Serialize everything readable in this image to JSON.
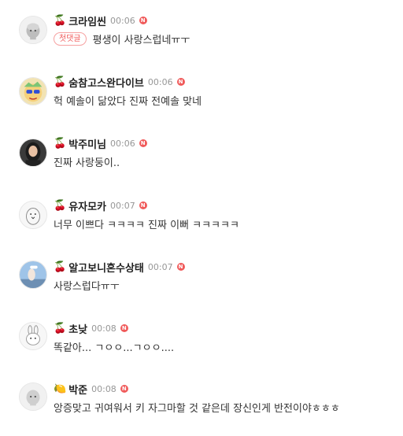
{
  "comments": [
    {
      "badge": "🍒",
      "nickname": "크라임씬",
      "time": "00:06",
      "new_badge": "N",
      "tag": "첫댓글",
      "text": "평생이 사랑스럽네ㅠㅜ",
      "avatar_icon": "default-profile-icon"
    },
    {
      "badge": "🍒",
      "nickname": "숨참고스완다이브",
      "time": "00:06",
      "new_badge": "N",
      "text": "헉 예솔이 닮았다 진짜 전예솔 맞네",
      "avatar_icon": "cartoon-character-icon"
    },
    {
      "badge": "🍒",
      "nickname": "박주미님",
      "time": "00:06",
      "new_badge": "N",
      "text": "진짜 사랑둥이..",
      "avatar_icon": "photo-woman-icon"
    },
    {
      "badge": "🍒",
      "nickname": "유자모카",
      "time": "00:07",
      "new_badge": "N",
      "text": "너무 이쁘다 ㅋㅋㅋㅋ 진짜 이뻐 ㅋㅋㅋㅋㅋ",
      "avatar_icon": "penguin-icon"
    },
    {
      "badge": "🍒",
      "nickname": "알고보니혼수상태",
      "time": "00:07",
      "new_badge": "N",
      "text": "사랑스럽다ㅠㅜ",
      "avatar_icon": "photo-person-icon"
    },
    {
      "badge": "🍒",
      "nickname": "초낮",
      "time": "00:08",
      "new_badge": "N",
      "text": "똑같아... ㄱㅇㅇ...ㄱㅇㅇ....",
      "avatar_icon": "bunny-icon"
    },
    {
      "badge": "🍋",
      "nickname": "박준",
      "time": "00:08",
      "new_badge": "N",
      "text": "앙증맞고 귀여워서 키 자그마할 것 같은데 장신인게 반전이야ㅎㅎㅎ",
      "avatar_icon": "default-profile-icon"
    }
  ],
  "colors": {
    "new_badge": "#f05a5a",
    "time": "#979797",
    "tag": "#f05a5a"
  }
}
